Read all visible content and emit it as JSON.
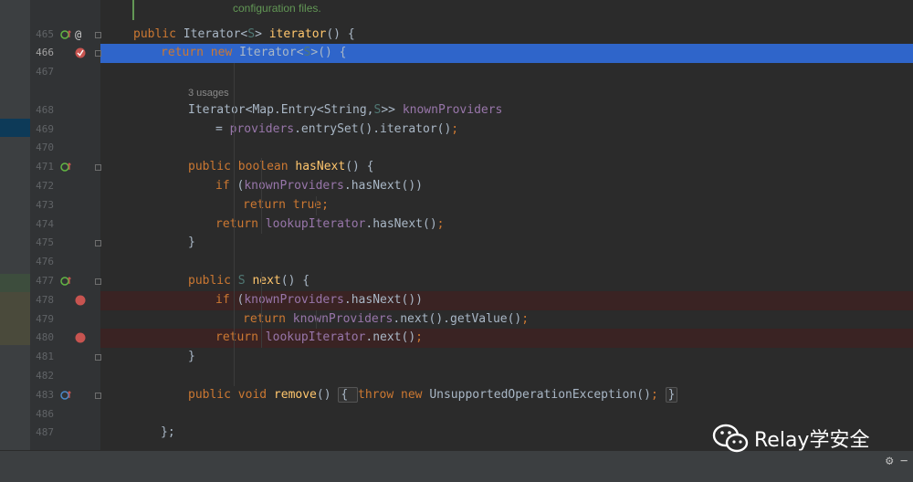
{
  "doc_comment": "configuration files.",
  "usages_hint": "3 usages",
  "lines": [
    {
      "n": "465",
      "tokens": [
        [
          "kw",
          "public "
        ],
        [
          "typ",
          "Iterator<"
        ],
        [
          "gen",
          "S"
        ],
        [
          "typ",
          "> "
        ],
        [
          "fn",
          "iterator"
        ],
        [
          "typ",
          "() {"
        ]
      ]
    },
    {
      "n": "466",
      "tokens": [
        [
          "kw",
          "return new "
        ],
        [
          "typ",
          "Iterator<"
        ],
        [
          "gen",
          "S"
        ],
        [
          "typ",
          ">() {"
        ]
      ]
    },
    {
      "n": "467",
      "tokens": []
    },
    {
      "n": "468",
      "tokens": [
        [
          "typ",
          "Iterator<Map.Entry<String,"
        ],
        [
          "gen",
          "S"
        ],
        [
          "typ",
          ">> "
        ],
        [
          "fld",
          "knownProviders"
        ]
      ]
    },
    {
      "n": "469",
      "tokens": [
        [
          "typ",
          "= "
        ],
        [
          "fld",
          "providers"
        ],
        [
          "typ",
          ".entrySet().iterator()"
        ],
        [
          "kw",
          ";"
        ]
      ]
    },
    {
      "n": "470",
      "tokens": []
    },
    {
      "n": "471",
      "tokens": [
        [
          "kw",
          "public boolean "
        ],
        [
          "fn",
          "hasNext"
        ],
        [
          "typ",
          "() {"
        ]
      ]
    },
    {
      "n": "472",
      "tokens": [
        [
          "kw",
          "if "
        ],
        [
          "typ",
          "("
        ],
        [
          "fld",
          "knownProviders"
        ],
        [
          "typ",
          ".hasNext())"
        ]
      ]
    },
    {
      "n": "473",
      "tokens": [
        [
          "kw",
          "return true;"
        ]
      ]
    },
    {
      "n": "474",
      "tokens": [
        [
          "kw",
          "return "
        ],
        [
          "fld",
          "lookupIterator"
        ],
        [
          "typ",
          ".hasNext()"
        ],
        [
          "kw",
          ";"
        ]
      ]
    },
    {
      "n": "475",
      "tokens": [
        [
          "typ",
          "}"
        ]
      ]
    },
    {
      "n": "476",
      "tokens": []
    },
    {
      "n": "477",
      "tokens": [
        [
          "kw",
          "public "
        ],
        [
          "gen",
          "S "
        ],
        [
          "fn",
          "next"
        ],
        [
          "typ",
          "() {"
        ]
      ]
    },
    {
      "n": "478",
      "tokens": [
        [
          "kw",
          "if "
        ],
        [
          "typ",
          "("
        ],
        [
          "fld",
          "knownProviders"
        ],
        [
          "typ",
          ".hasNext())"
        ]
      ]
    },
    {
      "n": "479",
      "tokens": [
        [
          "kw",
          "return "
        ],
        [
          "fld",
          "knownProviders"
        ],
        [
          "typ",
          ".next().getValue()"
        ],
        [
          "kw",
          ";"
        ]
      ]
    },
    {
      "n": "480",
      "tokens": [
        [
          "kw",
          "return "
        ],
        [
          "fld",
          "lookupIterator"
        ],
        [
          "typ",
          ".next()"
        ],
        [
          "kw",
          ";"
        ]
      ]
    },
    {
      "n": "481",
      "tokens": [
        [
          "typ",
          "}"
        ]
      ]
    },
    {
      "n": "482",
      "tokens": []
    },
    {
      "n": "483",
      "tokens": [
        [
          "kw",
          "public void "
        ],
        [
          "fn",
          "remove"
        ],
        [
          "typ",
          "() "
        ],
        [
          "fold",
          "{ "
        ],
        [
          "kw",
          "throw new "
        ],
        [
          "typ",
          "UnsupportedOperationException()"
        ],
        [
          "kw",
          "; "
        ],
        [
          "fold",
          "}"
        ]
      ]
    },
    {
      "n": "486",
      "tokens": []
    },
    {
      "n": "487",
      "tokens": [
        [
          "typ",
          "};"
        ]
      ]
    }
  ],
  "watermark_text": "Relay学安全",
  "colors": {
    "editor_bg": "#2b2b2b",
    "selection": "#2f65ca",
    "breakpoint_line": "#3a2323",
    "breakpoint": "#c75450",
    "keyword": "#cc7832",
    "method": "#ffc66d",
    "field": "#9876aa"
  },
  "icons": {
    "implements": "green-circle-up-arrow-icon",
    "annotation": "at-sign-icon",
    "breakpoint": "red-circle-breakpoint-icon",
    "debug_stop": "stop-breakpoint-icon",
    "settings": "gear-icon"
  }
}
